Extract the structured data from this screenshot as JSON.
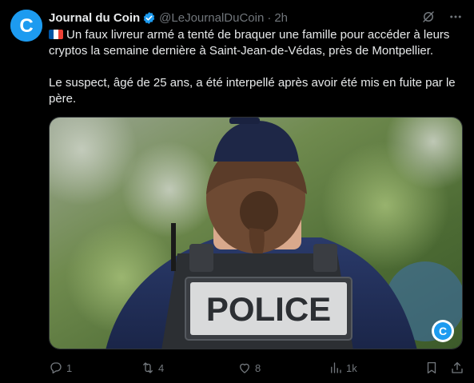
{
  "tweet": {
    "author": {
      "display_name": "Journal du Coin",
      "handle": "@LeJournalDuCoin",
      "time": "2h",
      "separator": "·",
      "avatar_letter": "C",
      "verified": true
    },
    "text": {
      "flag": "french-flag",
      "paragraph1": "Un faux livreur armé a tenté de braquer une famille pour accéder à leurs cryptos la semaine dernière à Saint-Jean-de-Védas, près de Montpellier.",
      "paragraph2": "Le suspect, âgé de 25 ans, a été interpellé après avoir été mis en fuite par le père."
    },
    "media": {
      "vest_text": "POLICE",
      "watermark_letter": "C"
    },
    "metrics": {
      "replies": "1",
      "retweets": "4",
      "likes": "8",
      "views": "1k"
    }
  },
  "colors": {
    "background": "#000000",
    "text_primary": "#e7e9ea",
    "text_secondary": "#71767b",
    "brand_blue": "#1d9bf0"
  },
  "icons": {
    "verified": "verified-badge-icon",
    "grok": "grok-icon",
    "more": "more-horizontal-icon",
    "reply": "reply-icon",
    "retweet": "retweet-icon",
    "like": "heart-icon",
    "views": "views-icon",
    "bookmark": "bookmark-icon",
    "share": "share-icon"
  }
}
